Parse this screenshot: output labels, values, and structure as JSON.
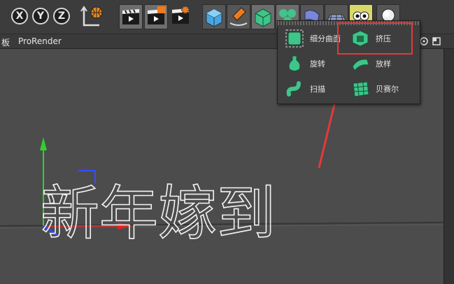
{
  "toolbar": {
    "axis_x": "X",
    "axis_y": "Y",
    "axis_z": "Z"
  },
  "menubar": {
    "items": [
      "板",
      "ProRender"
    ]
  },
  "popup": {
    "items": [
      {
        "label": "细分曲面",
        "icon": "subdivision-surface-icon"
      },
      {
        "label": "挤压",
        "icon": "extrude-icon"
      },
      {
        "label": "旋转",
        "icon": "lathe-icon"
      },
      {
        "label": "放样",
        "icon": "loft-icon"
      },
      {
        "label": "扫描",
        "icon": "sweep-icon"
      },
      {
        "label": "贝赛尔",
        "icon": "bezier-icon"
      }
    ]
  },
  "viewport": {
    "spline_text": "新年嫁到"
  },
  "colors": {
    "highlight": "#e23a3a",
    "menu_accent": "#ffd23a",
    "generator_green": "#3fc48a"
  }
}
